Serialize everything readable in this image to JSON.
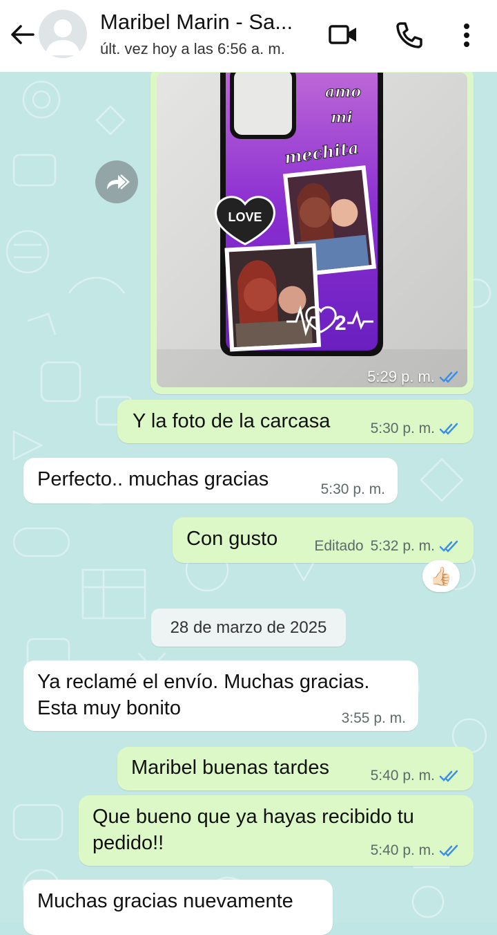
{
  "header": {
    "contact_name": "Maribel Marin - Sa...",
    "last_seen": "últ. vez hoy a las 6:56 a. m."
  },
  "phone_case_text": {
    "line1": "amo",
    "line2": "mi",
    "line3": "mechita",
    "love": "LOVE",
    "heart_number": "2"
  },
  "messages": [
    {
      "id": "m0",
      "direction": "out",
      "type": "image",
      "time": "5:29 p. m.",
      "status": "read"
    },
    {
      "id": "m1",
      "direction": "out",
      "text": "Y la foto de la carcasa",
      "time": "5:30 p. m.",
      "status": "read"
    },
    {
      "id": "m2",
      "direction": "in",
      "text": "Perfecto.. muchas gracias",
      "time": "5:30 p. m."
    },
    {
      "id": "m3",
      "direction": "out",
      "text": "Con gusto",
      "edited": "Editado",
      "time": "5:32 p. m.",
      "status": "read",
      "reaction": "👍🏻"
    },
    {
      "id": "m4",
      "direction": "in",
      "text_line1": "Ya reclamé el envío. Muchas gracias.",
      "text_line2": "Esta muy bonito",
      "time": "3:55 p. m."
    },
    {
      "id": "m5",
      "direction": "out",
      "text": "Maribel buenas tardes",
      "time": "5:40 p. m.",
      "status": "read"
    },
    {
      "id": "m6",
      "direction": "out",
      "text_line1": "Que bueno que ya hayas recibido tu",
      "text_line2": "pedido!!",
      "time": "5:40 p. m.",
      "status": "read"
    },
    {
      "id": "m7",
      "direction": "in",
      "text": "Muchas gracias nuevamente"
    }
  ],
  "date_divider": "28 de marzo de 2025",
  "colors": {
    "outgoing_bubble": "#dcf8c6",
    "incoming_bubble": "#ffffff",
    "wallpaper": "#c3e7e5",
    "read_ticks": "#3b8fe8"
  }
}
